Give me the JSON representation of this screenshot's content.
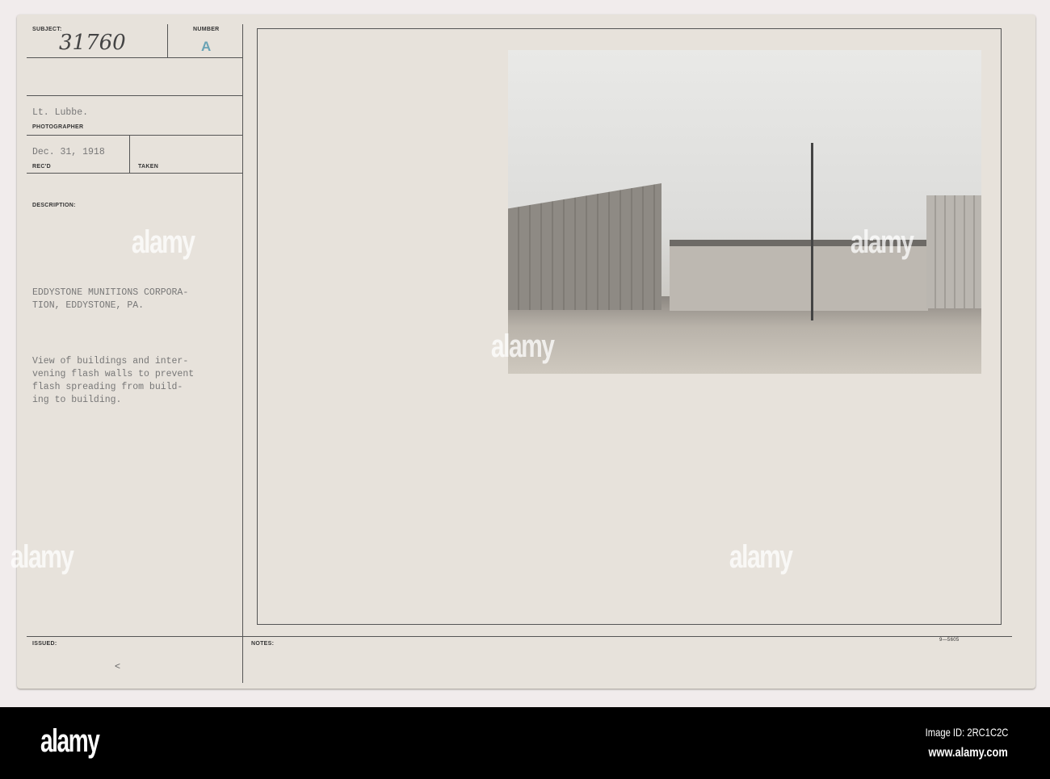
{
  "card": {
    "subject_label": "SUBJECT:",
    "subject_value": "31760",
    "number_label": "NUMBER",
    "number_value": "A",
    "photographer_value": "Lt. Lubbe.",
    "photographer_label": "PHOTOGRAPHER",
    "date_value": "Dec. 31, 1918",
    "recd_label": "REC'D",
    "taken_label": "TAKEN",
    "description_label": "DESCRIPTION:",
    "title_lines": [
      "EDDYSTONE MUNITIONS CORPORA-",
      "TION, EDDYSTONE, PA."
    ],
    "description_lines": [
      "View of buildings and inter-",
      "vening flash walls to prevent",
      "flash spreading from build-",
      "ing to building."
    ],
    "issued_label": "ISSUED:",
    "issued_mark": "<",
    "notes_label": "NOTES:",
    "form_number": "9—5605"
  },
  "footer": {
    "logo": "alamy",
    "image_id": "Image ID: 2RC1C2C",
    "url": "www.alamy.com"
  },
  "watermark": "alamy"
}
